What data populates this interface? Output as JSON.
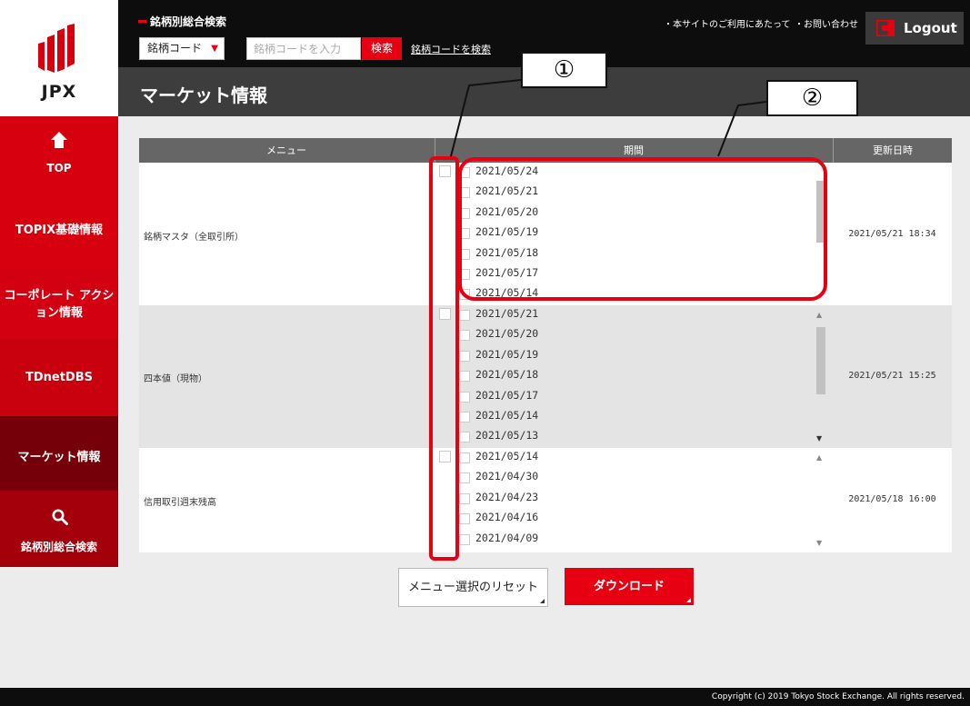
{
  "logo": {
    "text": "JPX"
  },
  "header": {
    "search_title": "銘柄別総合検索",
    "code_select_value": "銘柄コード",
    "code_input_placeholder": "銘柄コードを入力",
    "search_button": "検索",
    "code_search_link": "銘柄コードを検索",
    "link_terms": "・本サイトのご利用にあたって",
    "link_contact": "・お問い合わせ",
    "logout_button": "Logout"
  },
  "page": {
    "title": "マーケット情報"
  },
  "sidebar": {
    "items": [
      {
        "label": "TOP",
        "icon": "home-icon"
      },
      {
        "label": "TOPIX基礎情報"
      },
      {
        "label": "コーポレート アクション情報"
      },
      {
        "label": "TDnetDBS"
      },
      {
        "label": "マーケット情報",
        "active": true
      },
      {
        "label": "銘柄別総合検索",
        "icon": "search-icon"
      }
    ]
  },
  "table": {
    "headers": {
      "menu": "メニュー",
      "period": "期間",
      "updated": "更新日時"
    },
    "rows": [
      {
        "name": "銘柄マスタ（全取引所）",
        "dates": [
          "2021/05/24",
          "2021/05/21",
          "2021/05/20",
          "2021/05/19",
          "2021/05/18",
          "2021/05/17",
          "2021/05/14"
        ],
        "updated": "2021/05/21 18:34"
      },
      {
        "name": "四本値（現物）",
        "dates": [
          "2021/05/21",
          "2021/05/20",
          "2021/05/19",
          "2021/05/18",
          "2021/05/17",
          "2021/05/14",
          "2021/05/13"
        ],
        "updated": "2021/05/21 15:25"
      },
      {
        "name": "信用取引週末残高",
        "dates": [
          "2021/05/14",
          "2021/04/30",
          "2021/04/23",
          "2021/04/16",
          "2021/04/09"
        ],
        "updated": "2021/05/18 16:00"
      }
    ]
  },
  "buttons": {
    "reset": "メニュー選択のリセット",
    "download": "ダウンロード"
  },
  "callouts": {
    "one": "①",
    "two": "②"
  },
  "footer": {
    "copyright": "Copyright (c) 2019 Tokyo Stock Exchange. All rights reserved."
  },
  "colors": {
    "brand_red": "#e60012",
    "sidebar_active": "#75000a",
    "header_bg": "#0d0d0d",
    "title_bar": "#3d3d3d"
  }
}
